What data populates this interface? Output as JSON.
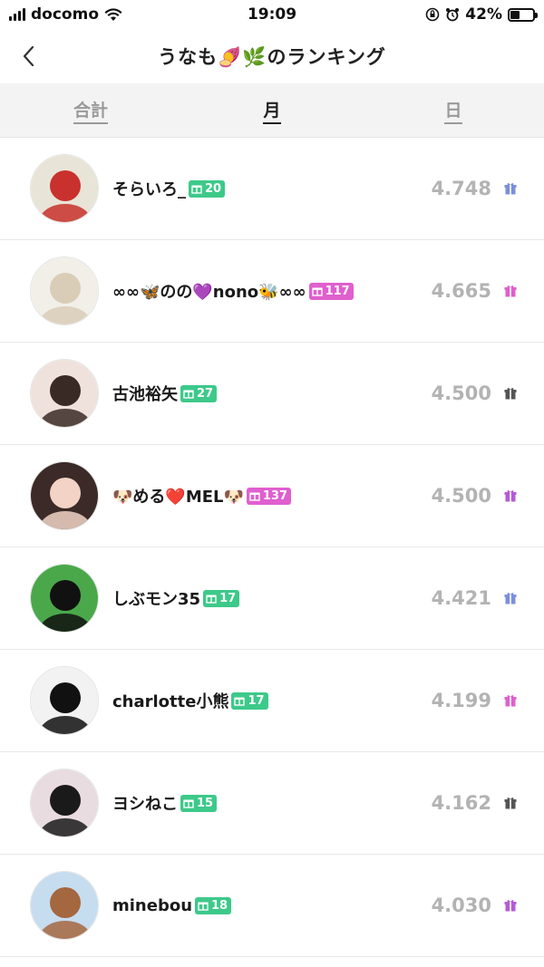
{
  "status": {
    "carrier": "docomo",
    "time": "19:09",
    "battery": "42%",
    "battery_level": 0.42
  },
  "nav": {
    "title": "うなも🍠🌿のランキング"
  },
  "tabs": [
    {
      "label": "合計",
      "active": false
    },
    {
      "label": "月",
      "active": true
    },
    {
      "label": "日",
      "active": false
    }
  ],
  "ranking": [
    {
      "name": "そらいろ_",
      "badge": "20",
      "badge_color": "#3dc98a",
      "score": "4.748",
      "gift_color": "#7b8fdc",
      "avatar_bg": "#e9e4d8",
      "avatar_fg": "#c8312d"
    },
    {
      "name": "∞∞🦋のの💜nono🐝∞∞",
      "badge": "117",
      "badge_color": "#e05fcf",
      "score": "4.665",
      "gift_color": "#e05fcf",
      "avatar_bg": "#f1efe8",
      "avatar_fg": "#d9cdb7"
    },
    {
      "name": "古池裕矢",
      "badge": "27",
      "badge_color": "#3dc98a",
      "score": "4.500",
      "gift_color": "#555555",
      "avatar_bg": "#efe2dc",
      "avatar_fg": "#3a2a26"
    },
    {
      "name": "🐶める❤️MEL🐶",
      "badge": "137",
      "badge_color": "#e05fcf",
      "score": "4.500",
      "gift_color": "#b45bd8",
      "avatar_bg": "#3b2a28",
      "avatar_fg": "#f2d3c5"
    },
    {
      "name": "しぶモン35",
      "badge": "17",
      "badge_color": "#3dc98a",
      "score": "4.421",
      "gift_color": "#7b8fdc",
      "avatar_bg": "#4aa84a",
      "avatar_fg": "#111111"
    },
    {
      "name": "charlotte小熊",
      "badge": "17",
      "badge_color": "#3dc98a",
      "score": "4.199",
      "gift_color": "#e05fcf",
      "avatar_bg": "#f2f2f2",
      "avatar_fg": "#111111"
    },
    {
      "name": "ヨシねこ",
      "badge": "15",
      "badge_color": "#3dc98a",
      "score": "4.162",
      "gift_color": "#555555",
      "avatar_bg": "#e9dce0",
      "avatar_fg": "#1a1a1a"
    },
    {
      "name": "minebou",
      "badge": "18",
      "badge_color": "#3dc98a",
      "score": "4.030",
      "gift_color": "#b45bd8",
      "avatar_bg": "#c6dcef",
      "avatar_fg": "#a4673f"
    }
  ]
}
